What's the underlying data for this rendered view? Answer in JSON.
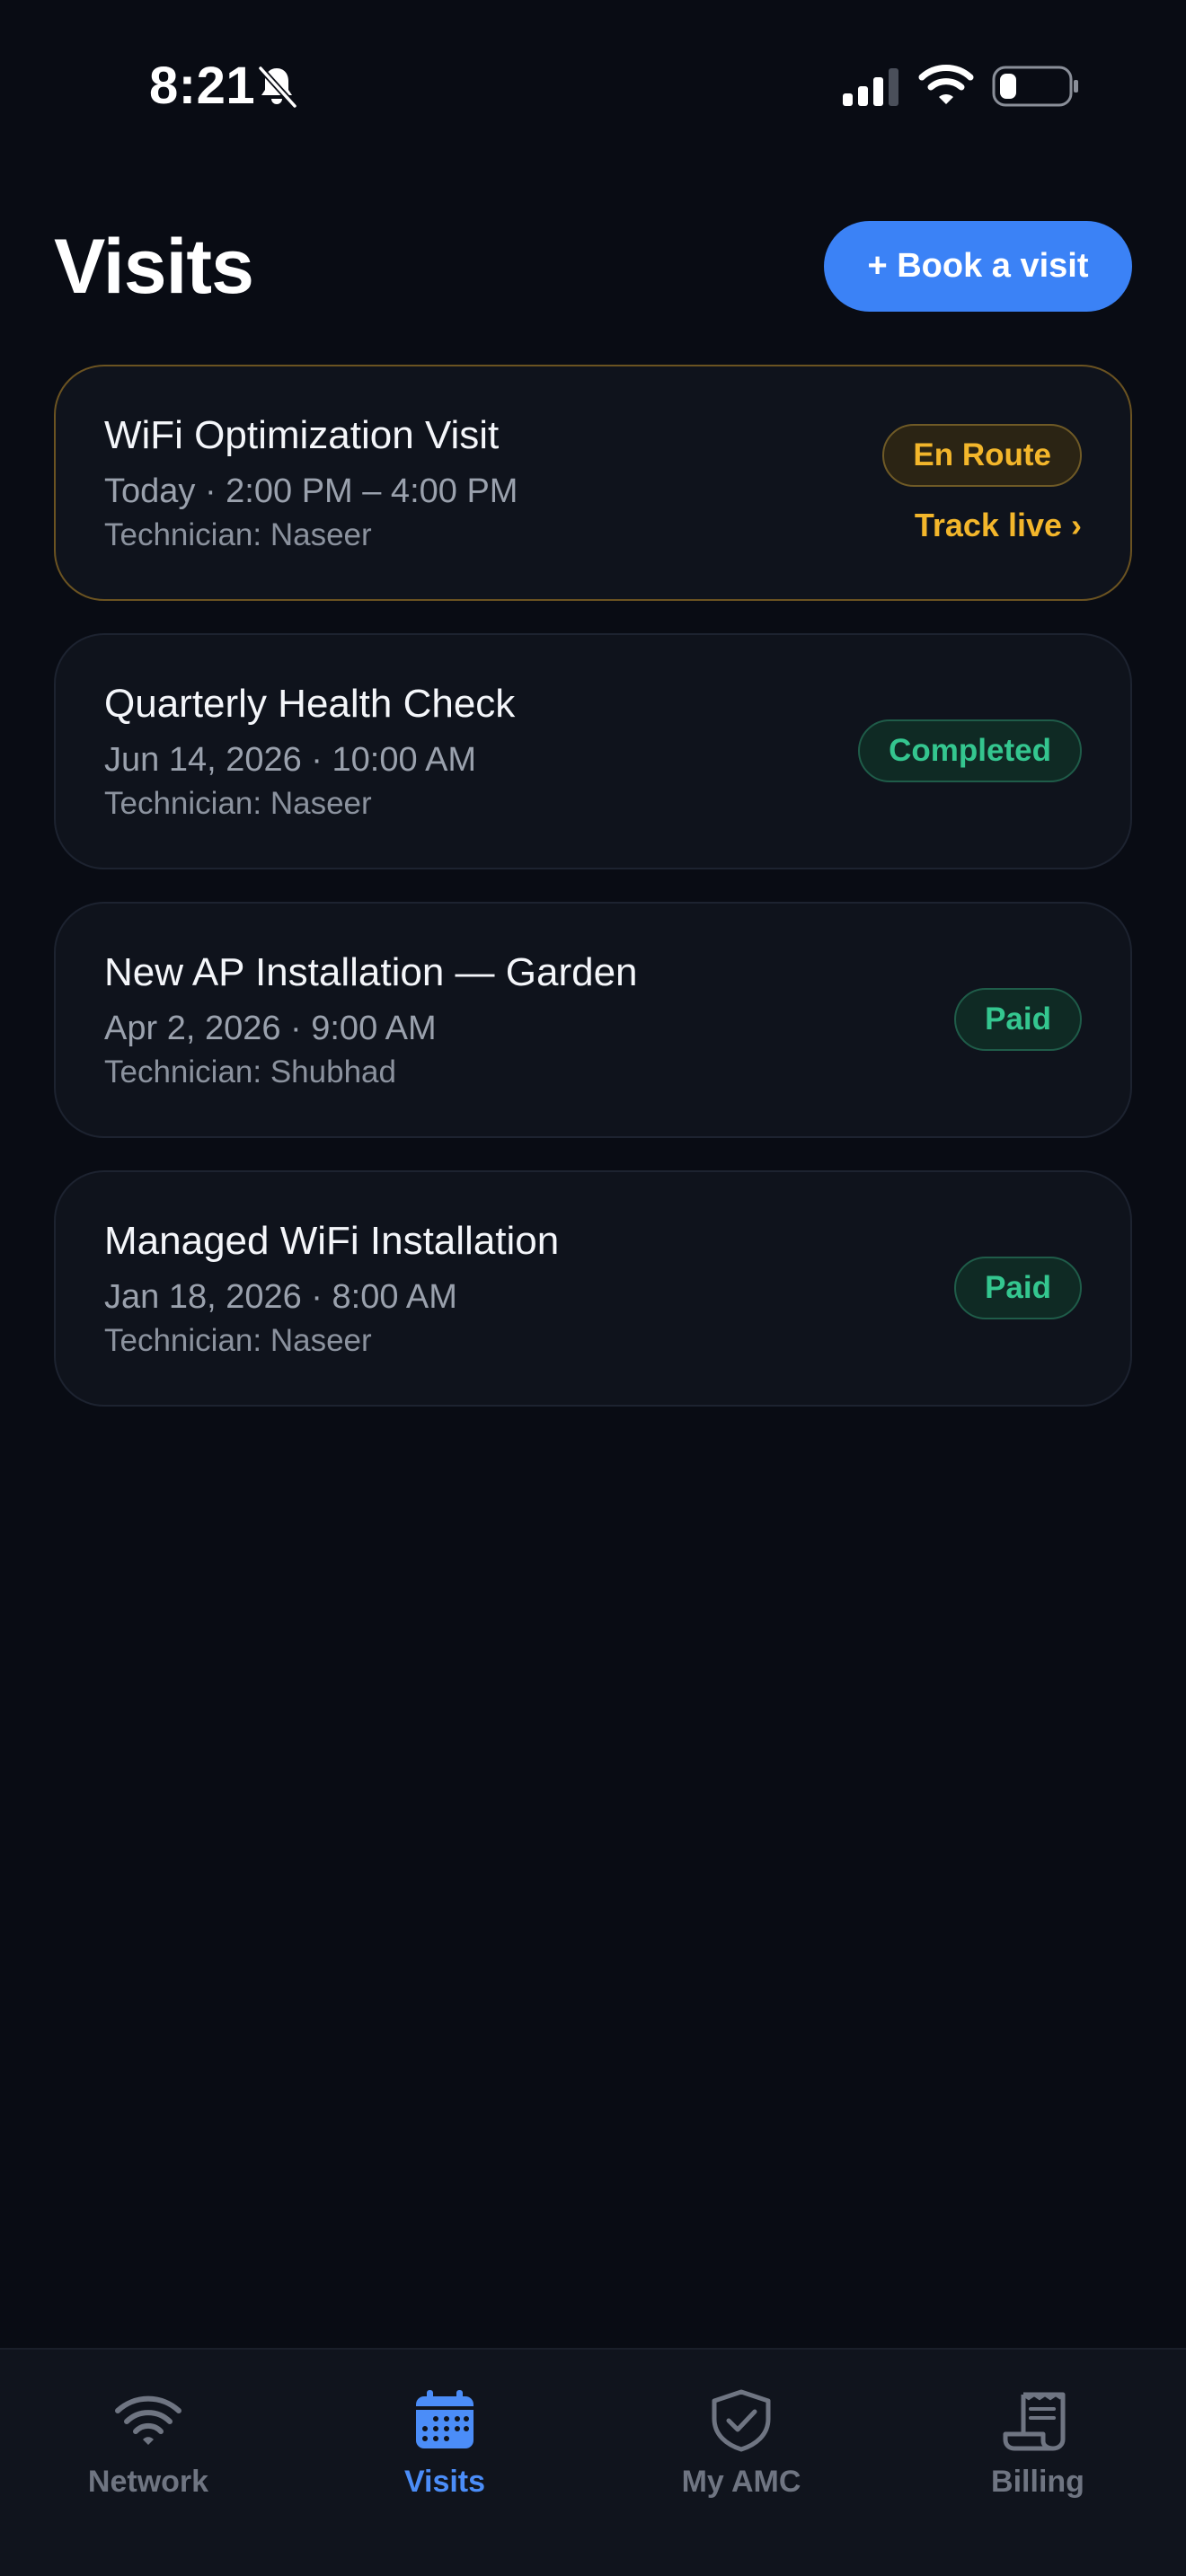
{
  "status_bar": {
    "time": "8:21",
    "icons": [
      "bell-slash-icon",
      "signal-icon",
      "wifi-icon",
      "battery-icon"
    ]
  },
  "header": {
    "title": "Visits",
    "book_button_label": "+ Book a visit"
  },
  "visits": [
    {
      "title": "WiFi Optimization Visit",
      "time": "Today · 2:00 PM – 4:00 PM",
      "technician": "Technician: Naseer",
      "status": "En Route",
      "action": "Track live ›"
    },
    {
      "title": "Quarterly Health Check",
      "time": "Jun 14, 2026 · 10:00 AM",
      "technician": "Technician: Naseer",
      "status": "Completed"
    },
    {
      "title": "New AP Installation — Garden",
      "time": "Apr 2, 2026 · 9:00 AM",
      "technician": "Technician: Shubhad",
      "status": "Paid"
    },
    {
      "title": "Managed WiFi Installation",
      "time": "Jan 18, 2026 · 8:00 AM",
      "technician": "Technician: Naseer",
      "status": "Paid"
    }
  ],
  "tabs": [
    {
      "label": "Network",
      "icon": "wifi-icon",
      "active": false
    },
    {
      "label": "Visits",
      "icon": "calendar-icon",
      "active": true
    },
    {
      "label": "My AMC",
      "icon": "shield-check-icon",
      "active": false
    },
    {
      "label": "Billing",
      "icon": "receipt-icon",
      "active": false
    }
  ],
  "colors": {
    "background": "#090c14",
    "accent": "#3b82f6",
    "active_tab": "#4b8df8",
    "en_route": "#f3b62b",
    "success": "#34c68f",
    "inactive": "#6f7582"
  }
}
